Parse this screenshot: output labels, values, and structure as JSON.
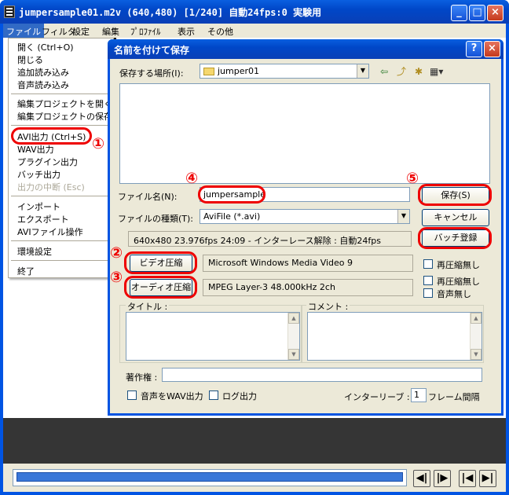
{
  "window": {
    "title": "jumpersample01.m2v (640,480) [1/240] 自動24fps:0 実験用"
  },
  "menubar": [
    "ファイル",
    "フィルタ",
    "設定",
    "編集",
    "ﾌﾟﾛﾌｧｲﾙ",
    "表示",
    "その他"
  ],
  "file_menu": {
    "items": [
      "開く (Ctrl+O)",
      "閉じる",
      "追加読み込み",
      "音声読み込み",
      "編集プロジェクトを開く",
      "編集プロジェクトの保存",
      "AVI出力 (Ctrl+S)",
      "WAV出力",
      "プラグイン出力",
      "バッチ出力",
      "出力の中断 (Esc)",
      "インポート",
      "エクスポート",
      "AVIファイル操作",
      "環境設定",
      "終了"
    ]
  },
  "dialog": {
    "title": "名前を付けて保存",
    "save_location_label": "保存する場所(I):",
    "save_location_value": "jumper01",
    "filename_label": "ファイル名(N):",
    "filename_value": "jumpersample",
    "filetype_label": "ファイルの種類(T):",
    "filetype_value": "AviFile (*.avi)",
    "save_button": "保存(S)",
    "cancel_button": "キャンセル",
    "batch_button": "バッチ登録",
    "info_text": "640x480  23.976fps  24:09  -  インターレース解除 : 自動24fps",
    "video_compress_button": "ビデオ圧縮",
    "video_codec": "Microsoft Windows Media Video 9",
    "audio_compress_button": "オーディオ圧縮",
    "audio_codec": "MPEG Layer-3 48.000kHz 2ch",
    "recompress_none_video": "再圧縮無し",
    "recompress_none_audio": "再圧縮無し",
    "no_audio": "音声無し",
    "title_label": "タイトル :",
    "comment_label": "コメント :",
    "copyright_label": "著作権 :",
    "wav_output": "音声をWAV出力",
    "log_output": "ログ出力",
    "interleave_label": "インターリーブ :",
    "interleave_value": "1",
    "interleave_unit": "フレーム間隔"
  },
  "annotations": [
    "①",
    "②",
    "③",
    "④",
    "⑤"
  ],
  "timeline": {
    "progress": 1.0
  },
  "colors": {
    "title_blue": "#0054e3",
    "highlight_red": "#e00000",
    "menu_highlight": "#316ac5"
  }
}
